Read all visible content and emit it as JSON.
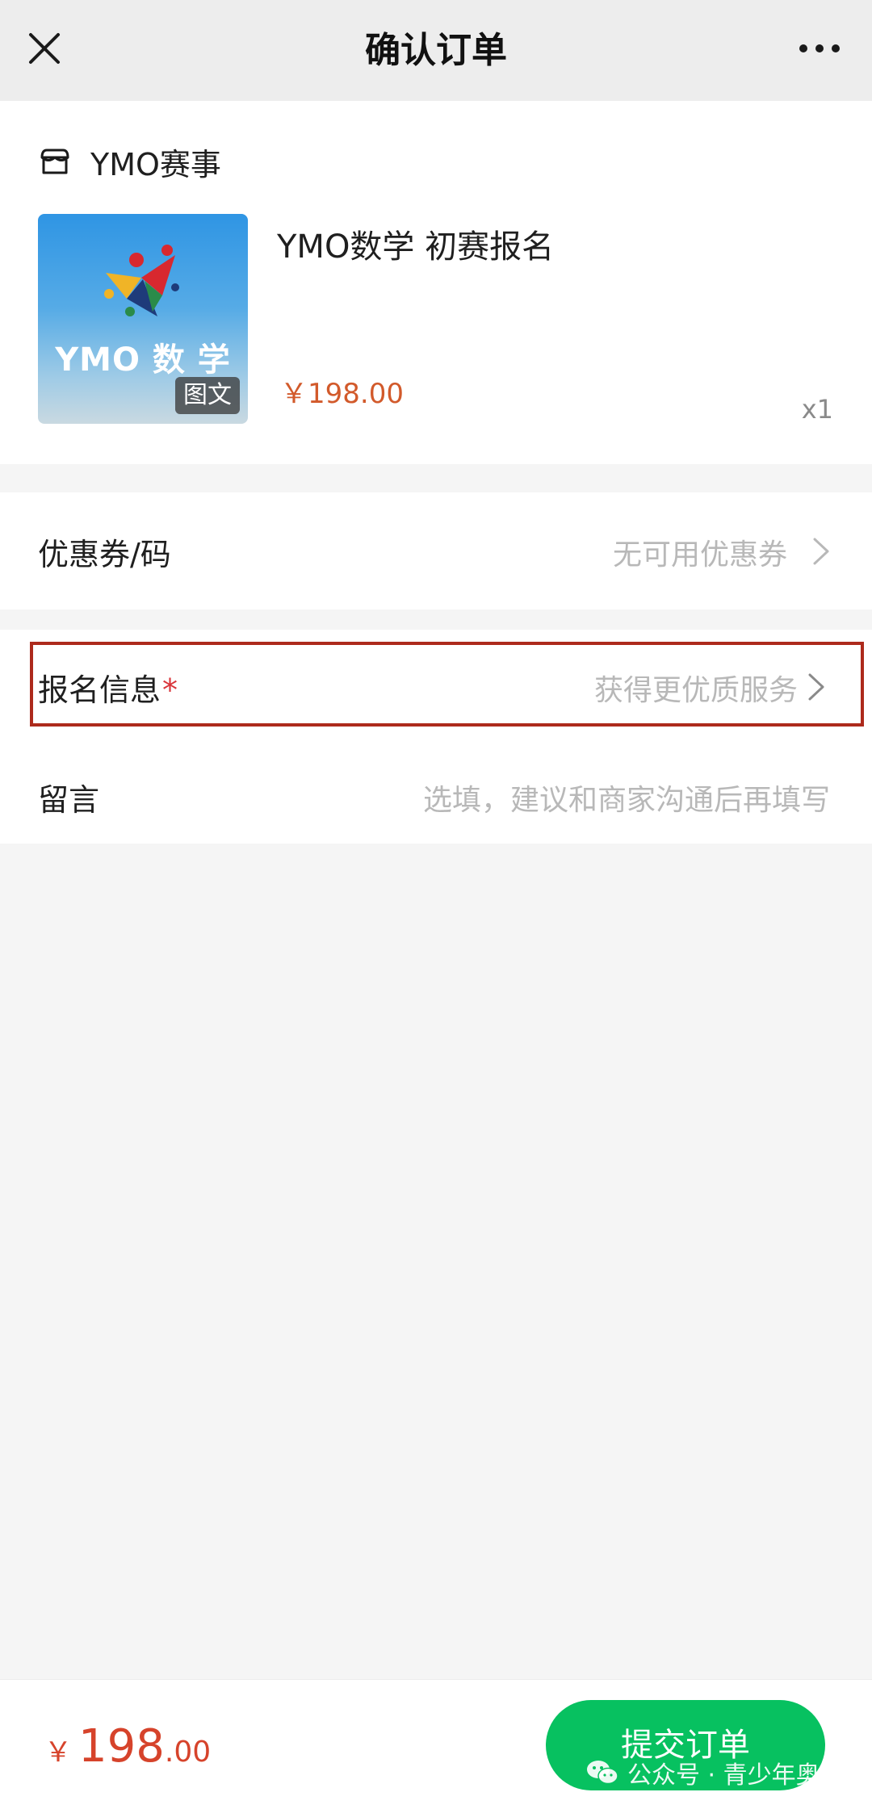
{
  "nav": {
    "title": "确认订单"
  },
  "shop": {
    "name": "YMO赛事"
  },
  "product": {
    "thumbnail_text": "YMO 数 学",
    "thumbnail_badge": "图文",
    "title": "YMO数学 初赛报名",
    "price": "￥198.00",
    "quantity": "x1"
  },
  "coupon": {
    "label": "优惠券/码",
    "value": "无可用优惠券"
  },
  "registration": {
    "label": "报名信息",
    "required_mark": "*",
    "value": "获得更优质服务"
  },
  "message": {
    "label": "留言",
    "placeholder": "选填，建议和商家沟通后再填写"
  },
  "footer": {
    "currency": "￥",
    "total_int": "198",
    "total_dec": ".00",
    "submit_label": "提交订单"
  },
  "watermark": {
    "text": "公众号 · 青少年奥赛"
  },
  "colors": {
    "accent_green": "#07c160",
    "price_orange": "#d25a2b",
    "highlight_red": "#ad2a1c"
  }
}
